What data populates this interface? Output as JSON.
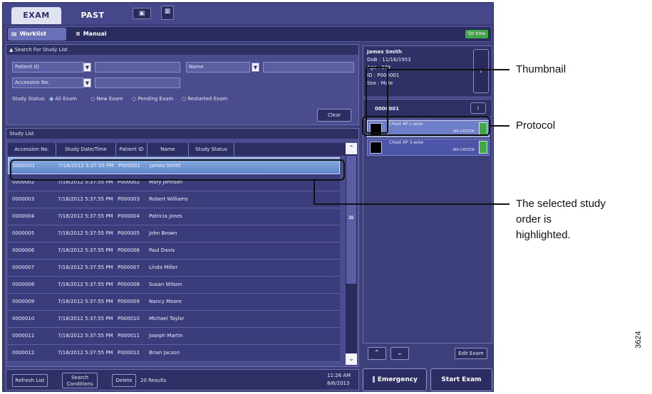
{
  "tabs": {
    "exam": "EXAM",
    "past": "PAST"
  },
  "subtabs": {
    "worklist": "Worklist",
    "manual": "Manual",
    "on_time": "On time"
  },
  "search": {
    "header": "Search For Study List",
    "patient_id_label": "Patient ID",
    "name_label": "Name",
    "accession_label": "Accession No.",
    "status_prefix": "Study Status:",
    "status_options": [
      "All Exam",
      "New Exam",
      "Pending Exam",
      "Restarted Exam"
    ],
    "clear": "Clear"
  },
  "study_list": {
    "header": "Study List",
    "columns": [
      "Accession No.",
      "Study Date/Time",
      "Patient ID",
      "Name",
      "Study Status"
    ],
    "rows": [
      {
        "acc": "0000001",
        "date": "7/18/2012 5:37:55 PM",
        "pid": "P000001",
        "name": "James Smith"
      },
      {
        "acc": "0000002",
        "date": "7/18/2012 5:37:55 PM",
        "pid": "P000002",
        "name": "Mary Johnson"
      },
      {
        "acc": "0000003",
        "date": "7/18/2012 5:37:55 PM",
        "pid": "P000003",
        "name": "Robert Williams"
      },
      {
        "acc": "0000004",
        "date": "7/18/2012 5:37:55 PM",
        "pid": "P000004",
        "name": "Patricia Jones"
      },
      {
        "acc": "0000005",
        "date": "7/18/2012 5:37:55 PM",
        "pid": "P000005",
        "name": "John Brown"
      },
      {
        "acc": "0000006",
        "date": "7/18/2012 5:37:55 PM",
        "pid": "P000006",
        "name": "Paul Davis"
      },
      {
        "acc": "0000007",
        "date": "7/18/2012 5:37:55 PM",
        "pid": "P000007",
        "name": "Linda Miller"
      },
      {
        "acc": "0000008",
        "date": "7/18/2012 5:37:55 PM",
        "pid": "P000008",
        "name": "Susan Wilson"
      },
      {
        "acc": "0000009",
        "date": "7/18/2012 5:37:55 PM",
        "pid": "P000009",
        "name": "Nancy Moore"
      },
      {
        "acc": "0000010",
        "date": "7/18/2012 5:37:55 PM",
        "pid": "P000010",
        "name": "Michael Taylor"
      },
      {
        "acc": "0000011",
        "date": "7/18/2012 5:37:55 PM",
        "pid": "P000011",
        "name": "Joseph Martin"
      },
      {
        "acc": "0000012",
        "date": "7/18/2012 5:37:55 PM",
        "pid": "P000012",
        "name": "Brian Jacson"
      }
    ]
  },
  "footer": {
    "refresh": "Refresh List",
    "search_conditions_line1": "Search",
    "search_conditions_line2": "Conditions",
    "delete": "Delete",
    "results": "20 Results",
    "time": "11:26 AM",
    "date": "8/6/2013"
  },
  "patient": {
    "name": "James Smith",
    "dob": "DoB : 11/16/1953",
    "age": "Age : 58Y",
    "id": "ID : P000001",
    "sex": "Sex : Male"
  },
  "accession": {
    "number": "0000001",
    "info_icon": "i"
  },
  "protocols": [
    {
      "name": "Chest AP L-wise",
      "id": "WS-C4D5D6"
    },
    {
      "name": "Chest AP 3-wise",
      "id": "WS-C4D5D6"
    }
  ],
  "right_footer": {
    "edit_exam": "Edit Exam",
    "emergency": "Emergency",
    "start_exam": "Start Exam"
  },
  "callouts": {
    "thumbnail": "Thumbnail",
    "protocol": "Protocol",
    "selected_line1": "The selected study",
    "selected_line2": "order is",
    "selected_line3": "highlighted."
  },
  "figure_number": "3624"
}
